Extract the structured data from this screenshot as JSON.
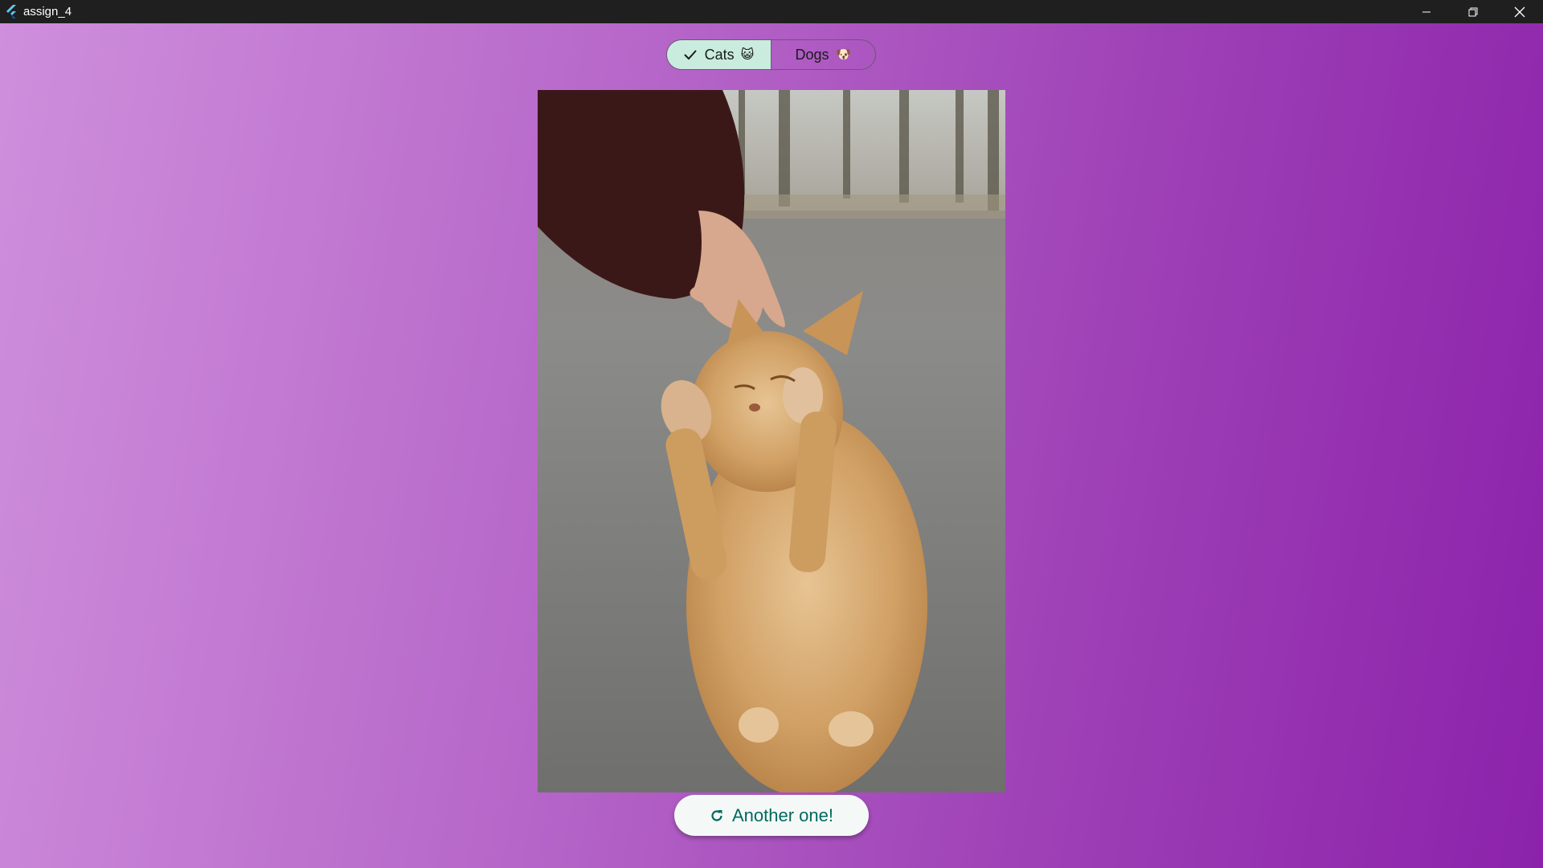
{
  "window": {
    "title": "assign_4"
  },
  "toggle": {
    "cats_label": "Cats",
    "cats_emoji": "😺",
    "dogs_label": "Dogs",
    "dogs_emoji": "🐶",
    "selected": "Cats"
  },
  "image": {
    "subject": "orange tabby cat standing on hind legs being petted",
    "selected_color": "#c9ecdf"
  },
  "actions": {
    "another_label": "Another one!"
  },
  "colors": {
    "accent_text": "#00695f",
    "background_start": "#cf8fdc",
    "background_end": "#8c22ab"
  }
}
